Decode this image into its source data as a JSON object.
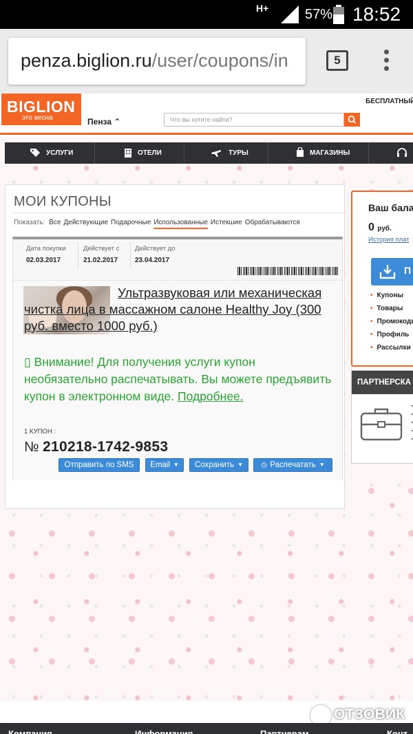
{
  "status_bar": {
    "network": "H+",
    "battery_percent": "57%",
    "time": "18:52"
  },
  "browser": {
    "url_host": "penza.biglion.ru",
    "url_path": "/user/coupons/in",
    "tab_count": "5"
  },
  "header": {
    "logo_text": "BIGLION",
    "logo_tagline": "это весна",
    "city": "Пенза",
    "search_placeholder": "Что вы хотите найти?",
    "top_link": "БЕСПЛАТНЫЙ З"
  },
  "nav": {
    "items": [
      {
        "label": "УСЛУГИ",
        "icon": "tag-icon"
      },
      {
        "label": "ОТЕЛИ",
        "icon": "hotel-icon"
      },
      {
        "label": "ТУРЫ",
        "icon": "plane-icon"
      },
      {
        "label": "МАГАЗИНЫ",
        "icon": "shopping-bag-icon"
      },
      {
        "label": "",
        "icon": "headphones-icon"
      }
    ]
  },
  "main": {
    "title": "МОИ КУПОНЫ",
    "filter_label": "Показать:",
    "filters": [
      "Все",
      "Действующие",
      "Подарочные",
      "Использованные",
      "Истекшие",
      "Обрабатываются"
    ],
    "active_filter": "Использованные"
  },
  "coupon": {
    "purchase_date_label": "Дата покупки",
    "purchase_date": "02.03.2017",
    "valid_from_label": "Действует с",
    "valid_from": "21.02.2017",
    "valid_to_label": "Действует до",
    "valid_to": "23.04.2017",
    "deal_title": "Ультразвуковая или механическая чистка лица в массажном салоне Healthy Joy (300 руб. вместо 1000 руб.)",
    "notice": "Внимание! Для получения услуги купон необязательно распечатывать. Вы можете предъявить купон в электронном виде.",
    "notice_more": "Подробнее.",
    "count_label": "1 КУПОН :",
    "number_prefix": "№",
    "number": "210218-1742-9853",
    "buttons": {
      "sms": "Отправить по SMS",
      "email": "Email",
      "save": "Сохранить",
      "print": "Распечатать"
    }
  },
  "sidebar": {
    "balance_title": "Ваш бала",
    "balance_value": "0",
    "balance_unit": "руб.",
    "history_link": "История плат",
    "button_label": "П",
    "menu": [
      "Купоны",
      "Товары",
      "Промокоды",
      "Профиль",
      "Рассылки"
    ],
    "partner_title": "ПАРТНЕРСКА"
  },
  "footer": {
    "links": [
      "Компания",
      "Информация",
      "Партнерам",
      "Конт"
    ]
  },
  "watermark": "ОТЗОВИК",
  "colors": {
    "brand_orange": "#f26522",
    "nav_dark": "#2e3033",
    "button_blue": "#3b8bd8",
    "notice_green": "#2aa332"
  }
}
